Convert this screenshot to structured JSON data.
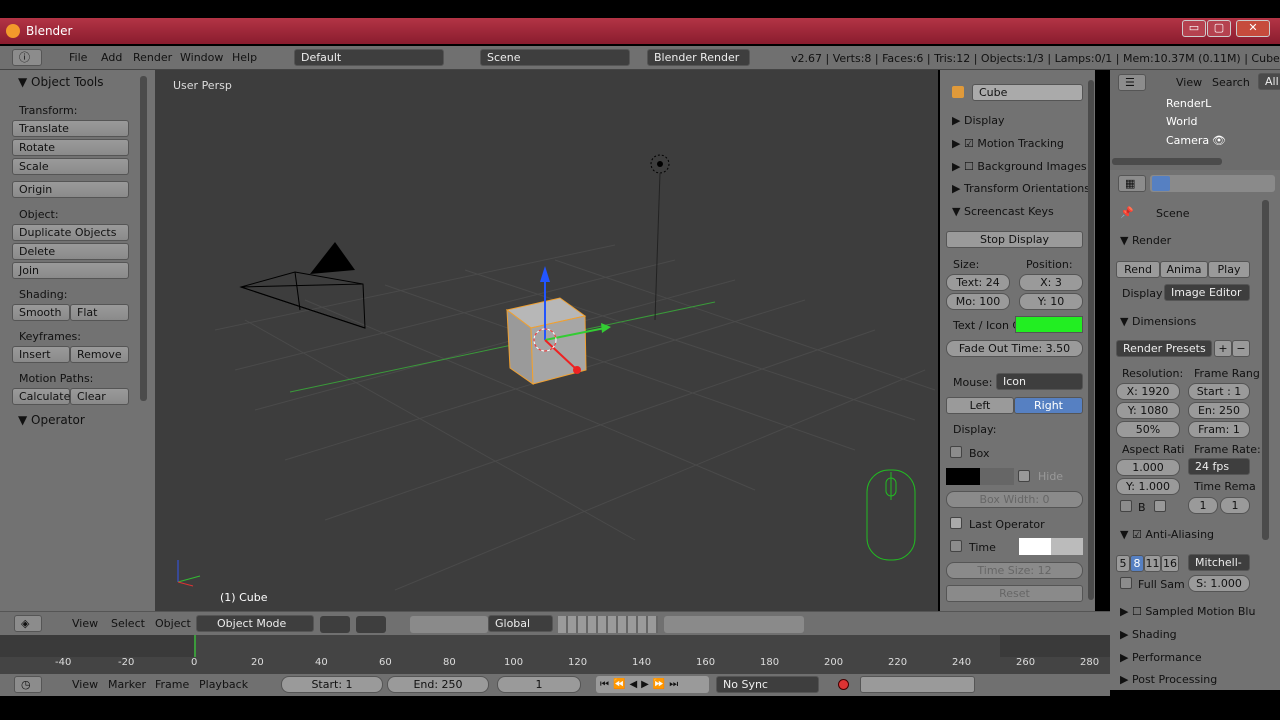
{
  "window": {
    "title": "Blender",
    "minimize": "▭",
    "maximize": "▢",
    "close": "✕"
  },
  "topbar": {
    "menus": [
      "File",
      "Add",
      "Render",
      "Window",
      "Help"
    ],
    "layout": "Default",
    "scene": "Scene",
    "engine": "Blender Render",
    "stats": "v2.67 | Verts:8 | Faces:6 | Tris:12 | Objects:1/3 | Lamps:0/1 | Mem:10.37M (0.11M) | Cube"
  },
  "tools": {
    "header": "Object Tools",
    "transform": "Transform:",
    "translate": "Translate",
    "rotate": "Rotate",
    "scale": "Scale",
    "origin": "Origin",
    "object": "Object:",
    "duplicate": "Duplicate Objects",
    "delete": "Delete",
    "join": "Join",
    "shading": "Shading:",
    "smooth": "Smooth",
    "flat": "Flat",
    "keyframes": "Keyframes:",
    "insert": "Insert",
    "remove": "Remove",
    "motion_paths": "Motion Paths:",
    "calculate": "Calculate",
    "clear": "Clear",
    "operator": "Operator"
  },
  "viewport": {
    "persp": "User Persp",
    "object_label": "(1) Cube"
  },
  "npanel": {
    "name": "Cube",
    "display": "Display",
    "motion_tracking": "Motion Tracking",
    "background_images": "Background Images",
    "transform_orientations": "Transform Orientations",
    "screencast_keys": "Screencast Keys",
    "stop_display": "Stop Display",
    "size": "Size:",
    "position": "Position:",
    "text_size": "Text: 24",
    "mo_size": "Mo: 100",
    "pos_x": "X: 3",
    "pos_y": "Y: 10",
    "text_icon": "Text / Icon C",
    "fade": "Fade Out Time: 3.50",
    "mouse": "Mouse:",
    "mouse_val": "Icon",
    "left": "Left",
    "right": "Right",
    "display2": "Display:",
    "box": "Box",
    "hide": "Hide",
    "box_width": "Box Width: 0",
    "last_operator": "Last Operator",
    "time": "Time",
    "time_size": "Time Size: 12",
    "reset": "Reset"
  },
  "vheader": {
    "view": "View",
    "select": "Select",
    "object": "Object",
    "mode": "Object Mode",
    "orientation": "Global"
  },
  "timeline": {
    "ticks": [
      "-40",
      "-20",
      "0",
      "20",
      "40",
      "60",
      "80",
      "100",
      "120",
      "140",
      "160",
      "180",
      "200",
      "220",
      "240",
      "260",
      "280"
    ],
    "view": "View",
    "marker": "Marker",
    "frame": "Frame",
    "playback": "Playback",
    "start": "Start: 1",
    "end": "End: 250",
    "current": "1",
    "sync": "No Sync"
  },
  "outliner": {
    "view": "View",
    "search": "Search",
    "all": "All",
    "items": [
      "RenderL",
      "World",
      "Camera"
    ]
  },
  "props": {
    "scene": "Scene",
    "render": "Render",
    "rend": "Rend",
    "anima": "Anima",
    "play": "Play",
    "display": "Display",
    "display_val": "Image Editor",
    "dimensions": "Dimensions",
    "presets": "Render Presets",
    "resolution": "Resolution:",
    "frame_range": "Frame Rang",
    "res_x": "X: 1920",
    "res_y": "Y: 1080",
    "res_pct": "50%",
    "start": "Start : 1",
    "end": "En: 250",
    "frame": "Fram: 1",
    "aspect": "Aspect Rati",
    "frame_rate": "Frame Rate:",
    "asp_x": "1.000",
    "asp_y": "Y: 1.000",
    "fps": "24 fps",
    "time_rema": "Time Rema",
    "b": "B",
    "t1": "1",
    "t2": "1",
    "anti_aliasing": "Anti-Aliasing",
    "aa": [
      "5",
      "8",
      "11",
      "16"
    ],
    "filter": "Mitchell-",
    "full_sam": "Full Sam",
    "s_val": "S: 1.000",
    "sampled_motion": "Sampled Motion Blu",
    "shading": "Shading",
    "performance": "Performance",
    "post": "Post Processing"
  },
  "colors": {
    "text_icon_color": "#22ee22",
    "selected": "#5680c2",
    "titlebar": "#a02838"
  }
}
